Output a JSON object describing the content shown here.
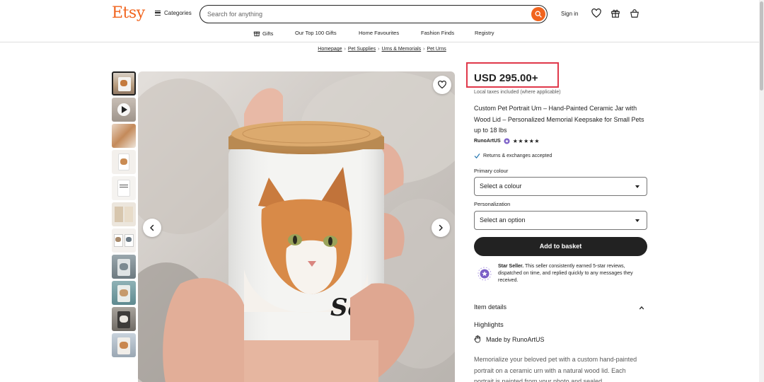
{
  "header": {
    "logo": "Etsy",
    "categories_label": "Categories",
    "search_placeholder": "Search for anything",
    "signin_label": "Sign in",
    "icons": [
      "heart-icon",
      "gift-icon",
      "basket-icon"
    ]
  },
  "nav": {
    "items": [
      "Gifts",
      "Our Top 100 Gifts",
      "Home Favourites",
      "Fashion Finds",
      "Registry"
    ]
  },
  "breadcrumb": [
    "Homepage",
    "Pet Supplies",
    "Urns & Memorials",
    "Pet Urns"
  ],
  "gallery": {
    "main_image_text": "Sam",
    "thumbnail_count": 11
  },
  "product": {
    "price": "USD 295.00+",
    "tax_note": "Local taxes included (where applicable)",
    "title": "Custom Pet Portrait Urn – Hand-Painted Ceramic Jar with Wood Lid – Personalized Memorial Keepsake for Small Pets up to 18 lbs",
    "shop_name": "RunoArtUS",
    "rating_stars": 5,
    "stars_text": "★★★★★",
    "returns": "Returns & exchanges accepted",
    "primary_colour_label": "Primary colour",
    "primary_colour_value": "Select a colour",
    "personalization_label": "Personalization",
    "personalization_value": "Select an option",
    "add_to_basket": "Add to basket",
    "star_seller_bold": "Star Seller.",
    "star_seller_text": " This seller consistently earned 5-star reviews, dispatched on time, and replied quickly to any messages they received.",
    "item_details_label": "Item details",
    "highlights_label": "Highlights",
    "made_by_prefix": "Made by ",
    "made_by_shop": "RunoArtUS",
    "description": "Memorialize your beloved pet with a custom hand-painted portrait on a ceramic urn with a natural wood lid. Each portrait is painted from your photo and sealed"
  },
  "colors": {
    "brand": "#f1641e",
    "highlight_box": "#e0384a",
    "button_dark": "#222222",
    "star_seller": "#7b5fc7"
  }
}
